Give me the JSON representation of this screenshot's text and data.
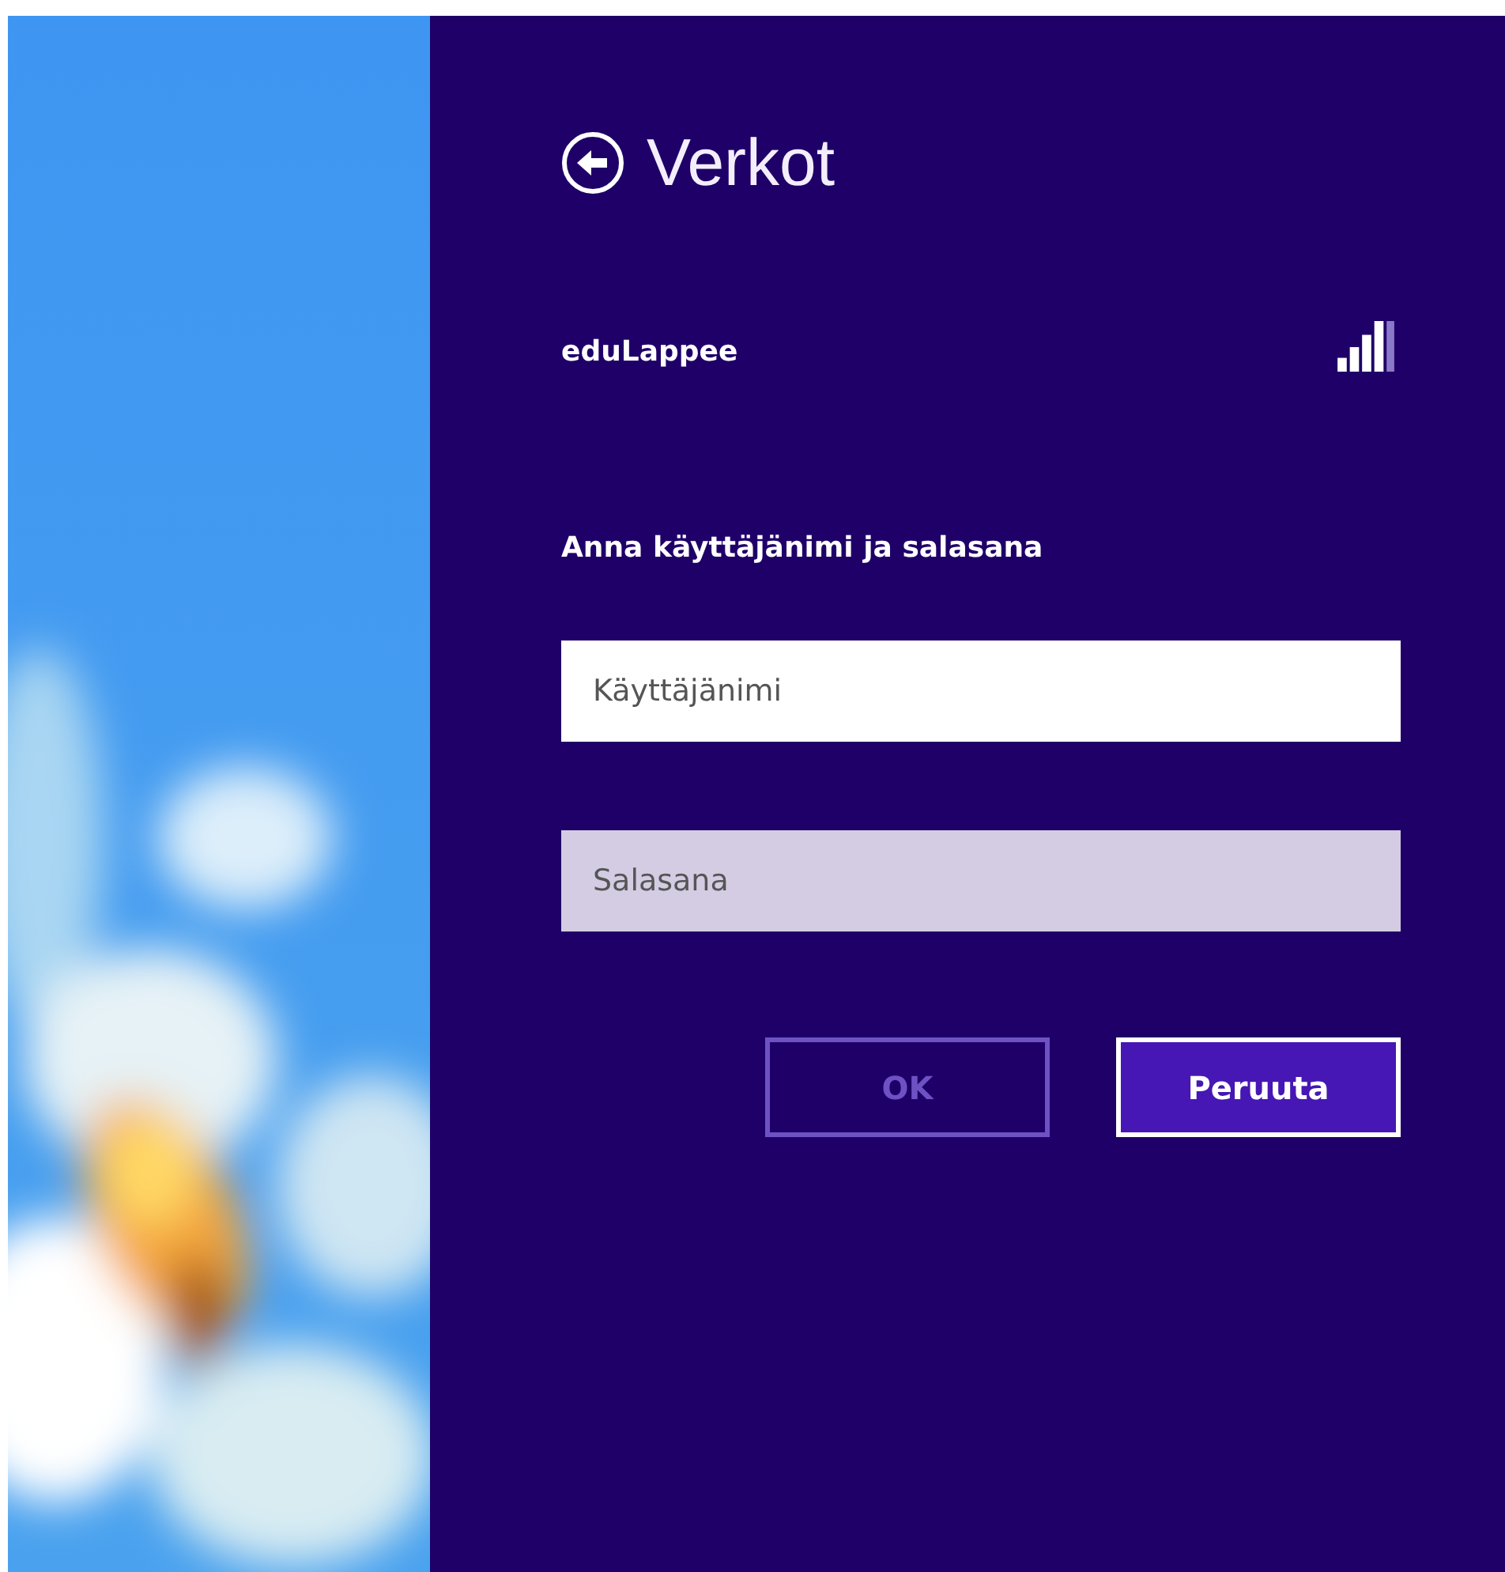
{
  "panel": {
    "title": "Verkot",
    "network": {
      "name": "eduLappee"
    },
    "prompt": "Anna käyttäjänimi ja salasana",
    "fields": [
      {
        "placeholder": "Käyttäjänimi",
        "focused": true
      },
      {
        "placeholder": "Salasana",
        "focused": false
      }
    ],
    "buttons": [
      {
        "label": "OK",
        "disabled": true,
        "primary": false
      },
      {
        "label": "Peruuta",
        "disabled": false,
        "primary": true
      }
    ]
  }
}
